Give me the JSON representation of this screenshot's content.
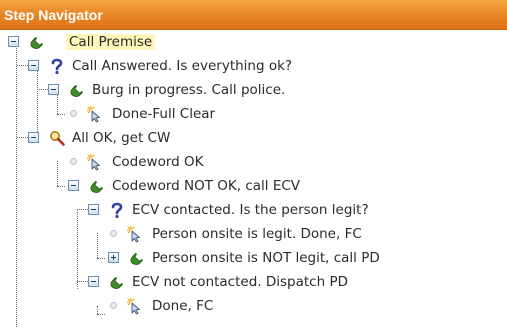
{
  "panel": {
    "title": "Step Navigator"
  },
  "tree": {
    "nodes": [
      {
        "label": "Call Premise",
        "icon": "phone-icon",
        "state": "expanded"
      },
      {
        "label": "Call Answered.  Is everything ok?",
        "icon": "question-icon",
        "state": "expanded"
      },
      {
        "label": "Burg in progress.  Call police.",
        "icon": "phone-icon",
        "state": "expanded"
      },
      {
        "label": "Done-Full Clear",
        "icon": "finish-cursor-icon",
        "state": "leaf"
      },
      {
        "label": "All OK, get CW",
        "icon": "magnifier-icon",
        "state": "expanded"
      },
      {
        "label": "Codeword OK",
        "icon": "finish-cursor-icon",
        "state": "leaf"
      },
      {
        "label": "Codeword NOT OK, call ECV",
        "icon": "phone-icon",
        "state": "expanded"
      },
      {
        "label": "ECV contacted. Is the person legit?",
        "icon": "question-icon",
        "state": "expanded"
      },
      {
        "label": "Person onsite is legit. Done, FC",
        "icon": "finish-cursor-icon",
        "state": "leaf"
      },
      {
        "label": "Person onsite is NOT legit, call PD",
        "icon": "phone-icon",
        "state": "collapsed"
      },
      {
        "label": "ECV not contacted.  Dispatch PD",
        "icon": "phone-icon",
        "state": "expanded"
      },
      {
        "label": "Done, FC",
        "icon": "finish-cursor-icon",
        "state": "leaf"
      }
    ]
  },
  "colors": {
    "header": "#e9892a",
    "selected_highlight": "#fff6ba",
    "phone": "#3c8a2a",
    "question": "#2d3fa8",
    "magnifier": "#c08a18"
  }
}
